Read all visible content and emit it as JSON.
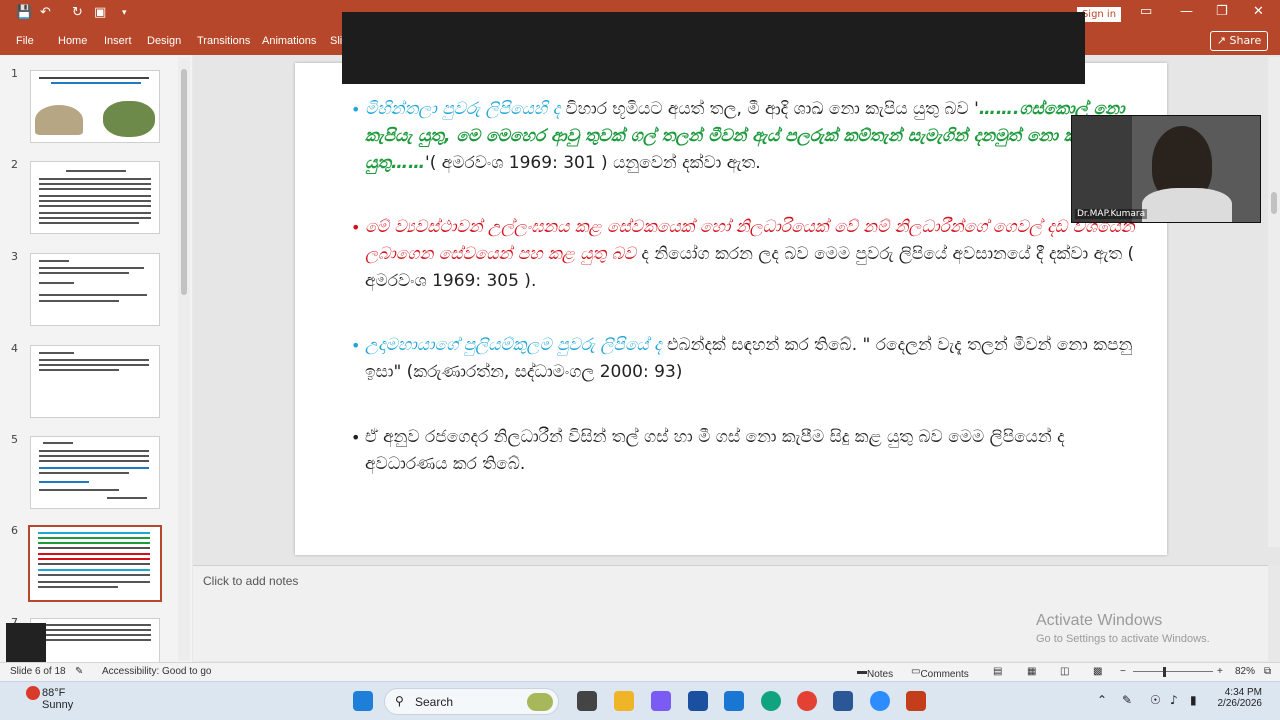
{
  "titlebar": {
    "signin": "Sign in"
  },
  "tabs": [
    "File",
    "Home",
    "Insert",
    "Design",
    "Transitions",
    "Animations",
    "Sli"
  ],
  "share": "Share",
  "thumbs": [
    "1",
    "2",
    "3",
    "4",
    "5",
    "6",
    "7"
  ],
  "slide": {
    "b1": {
      "cyan": "මිහින්තලා පුවරු ලිපියෙහි ද",
      "p1": " විහාර භූමියට අයත් තල, මී ආදි ශාඛ නො කැපිය යුතු බව '",
      "green": "…….ගස්කොල් නො කැපියැ යුතු, මෙ මෙහෙර ආවු තුවක් ගල් තලන් මීවන් ඇය් පලරුක් කම්තැන් සැමැගින් දනමුත් නො කැපියැ යුතු……",
      "p2": "'( අමරවංශ 1969: 301 ) යනුවෙන් දක්වා ඇත."
    },
    "b2": {
      "red": "මේ ව්‍යවස්ථාවන් උල්ලංඝනය කළ සේවකයෙක් හෝ නිලධාරියෙක් වේ නම් නිලධාරීන්ගේ ගෙවල් දඩ වශයෙන් ලබාගෙන සේවයෙන් පහ කළ යුතු බව",
      "p1": " ද නියෝග කරන ලද බව මෙම පුවරු ලිපියේ අවසානයේ දී දක්වා ඇත ( අමරවංශ 1969: 305 )."
    },
    "b3": {
      "cyan": "උදාමහායාගේ පුලියම්කුලම පුවරු ලිපියේ ද",
      "p1": " එබන්දක් සඳහන් කර තිබේ. \" රදෙලන් වැදැ තලන් මීවන් නො කපනු ඉසා\" (කරුණාරත්න, සද්ධාමංගල 2000: 93)"
    },
    "b4": "ඒ අනුව රජගෙදර නිලධාරීන් විසින් තල් ගස් හා මී ගස් නො කැපීම සිදු කළ යුතු බව මෙම ලිපියෙන් ද අවධාරණය කර තිබේ."
  },
  "video": {
    "name": "Dr.MAP.Kumara"
  },
  "notes": {
    "placeholder": "Click to add notes"
  },
  "activate": {
    "title": "Activate Windows",
    "sub": "Go to Settings to activate Windows."
  },
  "status": {
    "slide": "Slide 6 of 18",
    "accessibility": "Accessibility: Good to go",
    "notes": "Notes",
    "comments": "Comments",
    "zoom": "82%"
  },
  "taskbar": {
    "temp": "88°F",
    "cond": "Sunny",
    "search": "Search",
    "time": "4:34 PM",
    "date": "2/26/2026"
  }
}
